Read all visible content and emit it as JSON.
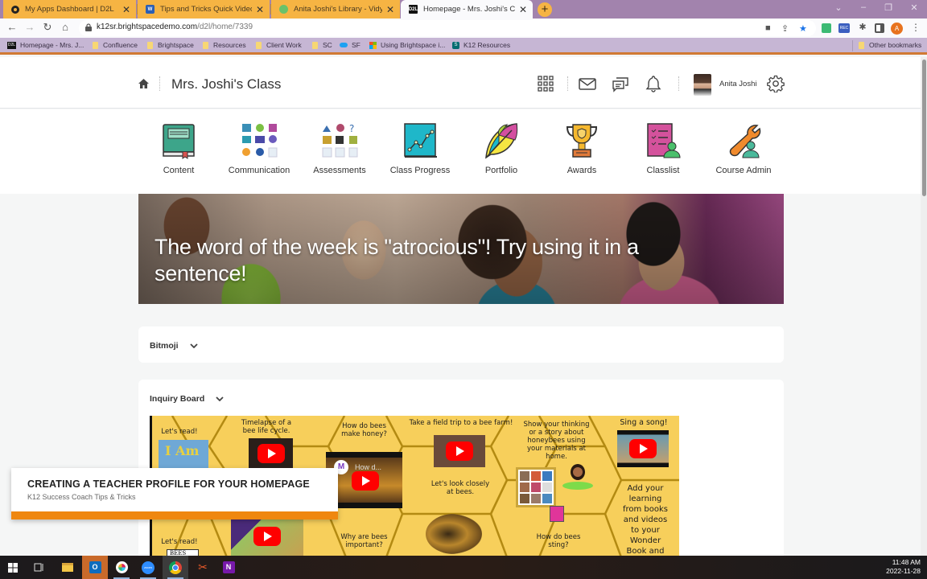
{
  "browser": {
    "tabs": [
      {
        "title": "My Apps Dashboard | D2L",
        "icon": "circle-logo-icon",
        "active": false
      },
      {
        "title": "Tips and Tricks Quick Videos.docx",
        "icon": "word-icon",
        "active": false
      },
      {
        "title": "Anita Joshi's Library - Vidyard",
        "icon": "vidyard-icon",
        "active": false
      },
      {
        "title": "Homepage - Mrs. Joshi's Class",
        "icon": "d2l-icon",
        "active": true
      }
    ],
    "url_host": "k12sr.brightspacedemo.com",
    "url_path": "/d2l/home/7339",
    "profile_initial": "A",
    "ext_rec_label": "REC",
    "bookmarks": [
      {
        "label": "Homepage - Mrs. J...",
        "icon": "d2l"
      },
      {
        "label": "Confluence",
        "icon": "folder"
      },
      {
        "label": "Brightspace",
        "icon": "folder"
      },
      {
        "label": "Resources",
        "icon": "folder"
      },
      {
        "label": "Client Work",
        "icon": "folder"
      },
      {
        "label": "SC",
        "icon": "folder"
      },
      {
        "label": "SF",
        "icon": "cloud"
      },
      {
        "label": "Using Brightspace i...",
        "icon": "ms"
      },
      {
        "label": "K12 Resources",
        "icon": "sharepoint"
      }
    ],
    "other_bookmarks": "Other bookmarks"
  },
  "header": {
    "course_title": "Mrs. Joshi's Class",
    "user_name": "Anita Joshi"
  },
  "navbar": {
    "items": [
      {
        "label": "Content"
      },
      {
        "label": "Communication"
      },
      {
        "label": "Assessments"
      },
      {
        "label": "Class Progress"
      },
      {
        "label": "Portfolio"
      },
      {
        "label": "Awards"
      },
      {
        "label": "Classlist"
      },
      {
        "label": "Course Admin"
      }
    ]
  },
  "banner": {
    "text": "The word of the week is \"atrocious\"! Try using it in a sentence!"
  },
  "widgets": {
    "bitmoji": {
      "title": "Bitmoji"
    },
    "inquiry": {
      "title": "Inquiry Board"
    }
  },
  "board": {
    "cells": {
      "lets_read_1": "Let's read!",
      "timelapse": "Timelapse of a bee life cycle.",
      "honey": "How do bees make honey?",
      "field_trip": "Take a field trip to a bee farm!",
      "show_thinking": "Show your thinking or a story about honeybees using your materials at home.",
      "sing": "Sing a song!",
      "look_closely": "Let's look closely at bees.",
      "add_learning": "Add your learning from books and videos to your Wonder Book and your Portfolio.",
      "lets_read_2": "Let's read!",
      "why_important": "Why are bees important?",
      "sting": "How do bees sting?",
      "book_title_1": "I Am",
      "book_title_2": "BEES",
      "video_caption": "How d..."
    }
  },
  "toast": {
    "title": "CREATING A TEACHER PROFILE FOR YOUR HOMEPAGE",
    "subtitle": "K12 Success Coach Tips & Tricks"
  },
  "taskbar": {
    "time": "11:48 AM",
    "date": "2022-11-28"
  }
}
